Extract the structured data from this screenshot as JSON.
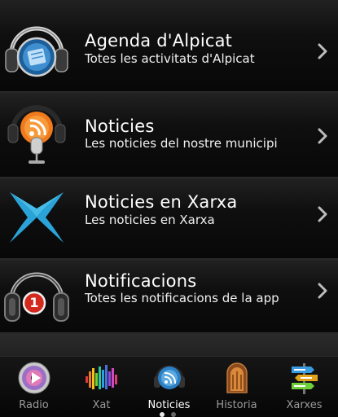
{
  "menu": {
    "items": [
      {
        "title": "Agenda d'Alpicat",
        "subtitle": "Totes les activitats d'Alpicat",
        "icon": "headphones-calendar-icon"
      },
      {
        "title": "Noticies",
        "subtitle": "Les noticies del nostre municipi",
        "icon": "rss-microphone-icon"
      },
      {
        "title": "Noticies en Xarxa",
        "subtitle": "Les noticies en Xarxa",
        "icon": "xarxa-x-logo-icon"
      },
      {
        "title": "Notificacions",
        "subtitle": "Totes les notificacions de la app",
        "icon": "headphones-badge-icon"
      }
    ],
    "badge_count": "1",
    "chevron_icon": "chevron-right-icon"
  },
  "tabbar": {
    "tabs": [
      {
        "label": "Radio",
        "icon": "radio-cd-icon"
      },
      {
        "label": "Xat",
        "icon": "equalizer-icon"
      },
      {
        "label": "Noticies",
        "icon": "rss-headphones-icon",
        "selected": true
      },
      {
        "label": "Historia",
        "icon": "jukebox-icon"
      },
      {
        "label": "Xarxes",
        "icon": "signpost-icon"
      }
    ],
    "page_indicator": {
      "pages": 2,
      "current": 1
    }
  },
  "colors": {
    "background": "#0b0b0b",
    "accent_orange": "#f07a1c",
    "accent_blue": "#2aa3d8",
    "badge_red": "#d42a1e"
  }
}
